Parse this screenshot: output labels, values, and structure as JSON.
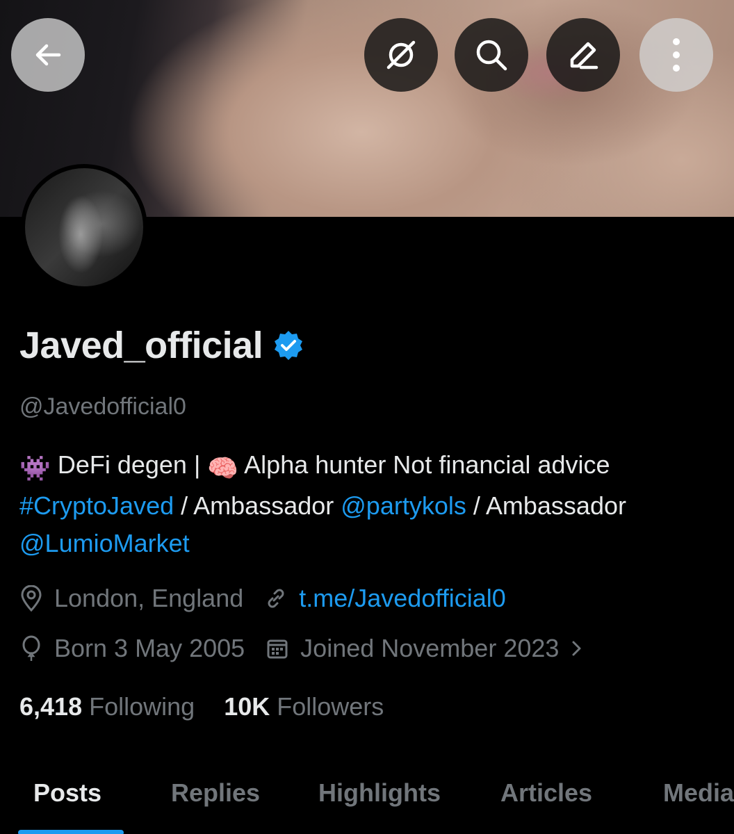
{
  "profile": {
    "display_name": "Javed_official",
    "handle": "@Javedofficial0",
    "verified": true,
    "bio": {
      "emoji1": "👾",
      "part1": " DeFi degen | ",
      "emoji2": "🧠",
      "part2": " Alpha hunter Not financial advice ",
      "hashtag": "#CryptoJaved",
      "part3": " / Ambassador ",
      "mention1": "@partykols",
      "part4": " / Ambassador ",
      "mention2": "@LumioMarket"
    },
    "location": "London, England",
    "website": "t.me/Javedofficial0",
    "birthday": "Born 3 May 2005",
    "joined": "Joined November 2023",
    "following_count": "6,418",
    "following_label": "Following",
    "followers_count": "10K",
    "followers_label": "Followers"
  },
  "header": {
    "back_icon": "arrow-left-icon",
    "grok_icon": "grok-icon",
    "search_icon": "search-icon",
    "edit_icon": "edit-icon",
    "more_icon": "more-vertical-icon"
  },
  "tabs": [
    {
      "label": "Posts",
      "active": true
    },
    {
      "label": "Replies",
      "active": false
    },
    {
      "label": "Highlights",
      "active": false
    },
    {
      "label": "Articles",
      "active": false
    },
    {
      "label": "Media",
      "active": false
    }
  ],
  "colors": {
    "accent": "#1d9bf0",
    "muted": "#71767b",
    "text": "#e7e9ea",
    "background": "#000000"
  }
}
